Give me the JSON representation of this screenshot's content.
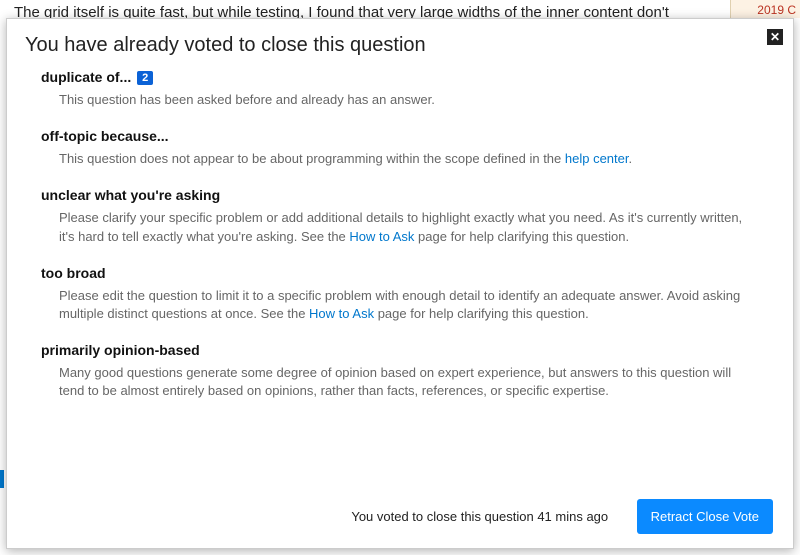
{
  "background": {
    "text": "The grid itself is quite fast, but while testing, I found that very large widths of the inner content don't",
    "right_label": "2019 C"
  },
  "modal": {
    "title": "You have already voted to close this question",
    "reasons": [
      {
        "title": "duplicate of...",
        "badge": "2",
        "desc_parts": [
          "This question has been asked before and already has an answer."
        ]
      },
      {
        "title": "off-topic because...",
        "desc_parts": [
          "This question does not appear to be about programming within the scope defined in the ",
          {
            "link": "help center"
          },
          "."
        ]
      },
      {
        "title": "unclear what you're asking",
        "desc_parts": [
          "Please clarify your specific problem or add additional details to highlight exactly what you need. As it's currently written, it's hard to tell exactly what you're asking. See the ",
          {
            "link": "How to Ask"
          },
          " page for help clarifying this question."
        ]
      },
      {
        "title": "too broad",
        "desc_parts": [
          "Please edit the question to limit it to a specific problem with enough detail to identify an adequate answer. Avoid asking multiple distinct questions at once. See the ",
          {
            "link": "How to Ask"
          },
          " page for help clarifying this question."
        ]
      },
      {
        "title": "primarily opinion-based",
        "desc_parts": [
          "Many good questions generate some degree of opinion based on expert experience, but answers to this question will tend to be almost entirely based on opinions, rather than facts, references, or specific expertise."
        ]
      }
    ],
    "footer": {
      "status": "You voted to close this question 41 mins ago",
      "button": "Retract Close Vote"
    }
  }
}
